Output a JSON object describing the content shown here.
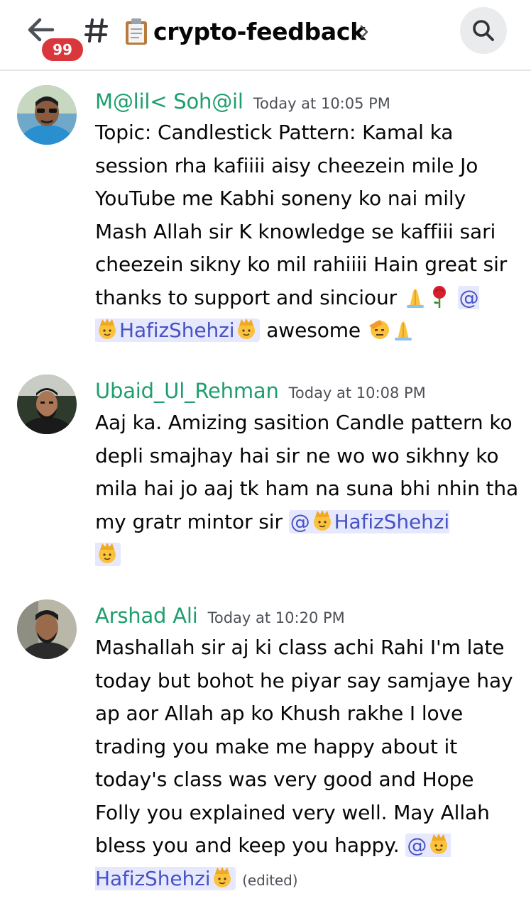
{
  "header": {
    "badge_count": "99",
    "channel_prefix": "#",
    "channel_name": "crypto-feedback"
  },
  "messages": [
    {
      "author": "M@lil< Soh@il",
      "timestamp": "Today at 10:05 PM",
      "text_1": "Topic: Candlestick Pattern: Kamal ka session rha kafiiii aisy cheezein mile Jo YouTube me Kabhi soneny ko nai mily Mash Allah sir K knowledge se kaffiii sari cheezein sikny ko mil rahiiii Hain great sir thanks to support and sinciour ",
      "mention_at": "@",
      "mention_name": "HafizShehzi",
      "text_2": " awesome "
    },
    {
      "author": "Ubaid_Ul_Rehman",
      "timestamp": "Today at 10:08 PM",
      "text_1": "Aaj ka. Amizing sasition Candle pattern ko depli smajhay hai sir ne wo wo sikhny ko mila hai jo aaj tk ham na suna bhi nhin tha my gratr mintor sir  ",
      "mention_at": "@",
      "mention_name": "HafizShehzi"
    },
    {
      "author": "Arshad Ali",
      "timestamp": "Today at 10:20 PM",
      "text_1": "Mashallah sir aj ki class achi Rahi I'm late today but bohot he piyar say samjaye hay ap aor Allah ap ko Khush rakhe I love trading you make me happy about it today's class was very good and Hope Folly you explained very well. May Allah bless you and keep you happy. ",
      "mention_at": "@",
      "mention_name": "HafizShehzi",
      "edited": "(edited)"
    }
  ],
  "colors": {
    "author": "#1e9e6e",
    "mention_bg": "#e6e8fd",
    "mention_text": "#4752c4",
    "badge": "#da373c"
  },
  "icons": [
    "back-arrow-icon",
    "hash-icon",
    "clipboard-icon",
    "chevron-right-icon",
    "search-icon",
    "folded-hands-emoji",
    "rose-emoji",
    "prince-emoji",
    "saluting-face-emoji"
  ]
}
